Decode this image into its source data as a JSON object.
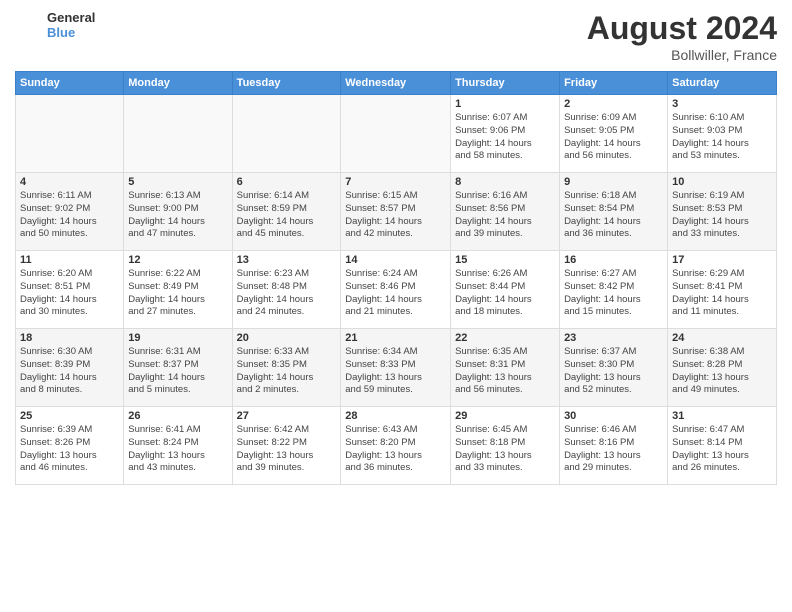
{
  "header": {
    "logo_line1": "General",
    "logo_line2": "Blue",
    "month_year": "August 2024",
    "location": "Bollwiller, France"
  },
  "weekdays": [
    "Sunday",
    "Monday",
    "Tuesday",
    "Wednesday",
    "Thursday",
    "Friday",
    "Saturday"
  ],
  "weeks": [
    [
      {
        "day": "",
        "info": ""
      },
      {
        "day": "",
        "info": ""
      },
      {
        "day": "",
        "info": ""
      },
      {
        "day": "",
        "info": ""
      },
      {
        "day": "1",
        "info": "Sunrise: 6:07 AM\nSunset: 9:06 PM\nDaylight: 14 hours\nand 58 minutes."
      },
      {
        "day": "2",
        "info": "Sunrise: 6:09 AM\nSunset: 9:05 PM\nDaylight: 14 hours\nand 56 minutes."
      },
      {
        "day": "3",
        "info": "Sunrise: 6:10 AM\nSunset: 9:03 PM\nDaylight: 14 hours\nand 53 minutes."
      }
    ],
    [
      {
        "day": "4",
        "info": "Sunrise: 6:11 AM\nSunset: 9:02 PM\nDaylight: 14 hours\nand 50 minutes."
      },
      {
        "day": "5",
        "info": "Sunrise: 6:13 AM\nSunset: 9:00 PM\nDaylight: 14 hours\nand 47 minutes."
      },
      {
        "day": "6",
        "info": "Sunrise: 6:14 AM\nSunset: 8:59 PM\nDaylight: 14 hours\nand 45 minutes."
      },
      {
        "day": "7",
        "info": "Sunrise: 6:15 AM\nSunset: 8:57 PM\nDaylight: 14 hours\nand 42 minutes."
      },
      {
        "day": "8",
        "info": "Sunrise: 6:16 AM\nSunset: 8:56 PM\nDaylight: 14 hours\nand 39 minutes."
      },
      {
        "day": "9",
        "info": "Sunrise: 6:18 AM\nSunset: 8:54 PM\nDaylight: 14 hours\nand 36 minutes."
      },
      {
        "day": "10",
        "info": "Sunrise: 6:19 AM\nSunset: 8:53 PM\nDaylight: 14 hours\nand 33 minutes."
      }
    ],
    [
      {
        "day": "11",
        "info": "Sunrise: 6:20 AM\nSunset: 8:51 PM\nDaylight: 14 hours\nand 30 minutes."
      },
      {
        "day": "12",
        "info": "Sunrise: 6:22 AM\nSunset: 8:49 PM\nDaylight: 14 hours\nand 27 minutes."
      },
      {
        "day": "13",
        "info": "Sunrise: 6:23 AM\nSunset: 8:48 PM\nDaylight: 14 hours\nand 24 minutes."
      },
      {
        "day": "14",
        "info": "Sunrise: 6:24 AM\nSunset: 8:46 PM\nDaylight: 14 hours\nand 21 minutes."
      },
      {
        "day": "15",
        "info": "Sunrise: 6:26 AM\nSunset: 8:44 PM\nDaylight: 14 hours\nand 18 minutes."
      },
      {
        "day": "16",
        "info": "Sunrise: 6:27 AM\nSunset: 8:42 PM\nDaylight: 14 hours\nand 15 minutes."
      },
      {
        "day": "17",
        "info": "Sunrise: 6:29 AM\nSunset: 8:41 PM\nDaylight: 14 hours\nand 11 minutes."
      }
    ],
    [
      {
        "day": "18",
        "info": "Sunrise: 6:30 AM\nSunset: 8:39 PM\nDaylight: 14 hours\nand 8 minutes."
      },
      {
        "day": "19",
        "info": "Sunrise: 6:31 AM\nSunset: 8:37 PM\nDaylight: 14 hours\nand 5 minutes."
      },
      {
        "day": "20",
        "info": "Sunrise: 6:33 AM\nSunset: 8:35 PM\nDaylight: 14 hours\nand 2 minutes."
      },
      {
        "day": "21",
        "info": "Sunrise: 6:34 AM\nSunset: 8:33 PM\nDaylight: 13 hours\nand 59 minutes."
      },
      {
        "day": "22",
        "info": "Sunrise: 6:35 AM\nSunset: 8:31 PM\nDaylight: 13 hours\nand 56 minutes."
      },
      {
        "day": "23",
        "info": "Sunrise: 6:37 AM\nSunset: 8:30 PM\nDaylight: 13 hours\nand 52 minutes."
      },
      {
        "day": "24",
        "info": "Sunrise: 6:38 AM\nSunset: 8:28 PM\nDaylight: 13 hours\nand 49 minutes."
      }
    ],
    [
      {
        "day": "25",
        "info": "Sunrise: 6:39 AM\nSunset: 8:26 PM\nDaylight: 13 hours\nand 46 minutes."
      },
      {
        "day": "26",
        "info": "Sunrise: 6:41 AM\nSunset: 8:24 PM\nDaylight: 13 hours\nand 43 minutes."
      },
      {
        "day": "27",
        "info": "Sunrise: 6:42 AM\nSunset: 8:22 PM\nDaylight: 13 hours\nand 39 minutes."
      },
      {
        "day": "28",
        "info": "Sunrise: 6:43 AM\nSunset: 8:20 PM\nDaylight: 13 hours\nand 36 minutes."
      },
      {
        "day": "29",
        "info": "Sunrise: 6:45 AM\nSunset: 8:18 PM\nDaylight: 13 hours\nand 33 minutes."
      },
      {
        "day": "30",
        "info": "Sunrise: 6:46 AM\nSunset: 8:16 PM\nDaylight: 13 hours\nand 29 minutes."
      },
      {
        "day": "31",
        "info": "Sunrise: 6:47 AM\nSunset: 8:14 PM\nDaylight: 13 hours\nand 26 minutes."
      }
    ]
  ]
}
